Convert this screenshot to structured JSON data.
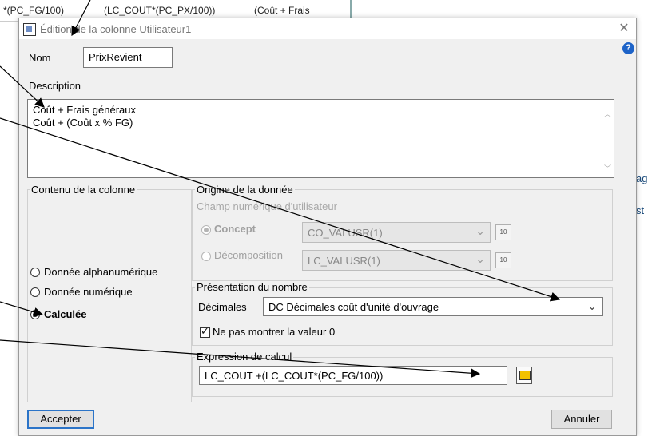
{
  "background": {
    "strip_text_1": "*(PC_FG/100)",
    "strip_text_2": "(LC_COUT*(PC_PX/100))",
    "strip_text_3": "(Coût + Frais",
    "right_fragment_1": "ag",
    "right_fragment_2": "st"
  },
  "dialog": {
    "title": "Édition de la colonne Utilisateur1",
    "close_glyph": "✕",
    "help_glyph": "?",
    "name_label": "Nom",
    "name_value": "PrixRevient",
    "description_label": "Description",
    "description_lines": [
      "Coût  + Frais généraux",
      "Coût +  (Coût x % FG)"
    ],
    "content_group": {
      "title": "Contenu de la colonne",
      "options": [
        {
          "label": "Donnée alphanumérique",
          "checked": false
        },
        {
          "label": "Donnée numérique",
          "checked": false
        },
        {
          "label": "Calculée",
          "checked": true
        }
      ]
    },
    "origin_group": {
      "title": "Origine de la donnée",
      "subtitle": "Champ numérique d'utilisateur",
      "concept_label": "Concept",
      "concept_value": "CO_VALUSR(1)",
      "decomposition_label": "Décomposition",
      "decomposition_value": "LC_VALUSR(1)"
    },
    "number_group": {
      "title": "Présentation du nombre",
      "decimals_label": "Décimales",
      "decimals_value": "DC Décimales coût d'unité d'ouvrage",
      "hide_zero_label": "Ne pas montrer la valeur 0",
      "hide_zero_checked": true
    },
    "expression_group": {
      "title": "Expression de calcul",
      "value": "LC_COUT +(LC_COUT*(PC_FG/100))"
    },
    "accept_label": "Accepter",
    "cancel_label": "Annuler"
  },
  "colors": {
    "accent": "#2b74c8",
    "dialog_bg": "#f0f0f0",
    "help_icon": "#1d63c8"
  }
}
